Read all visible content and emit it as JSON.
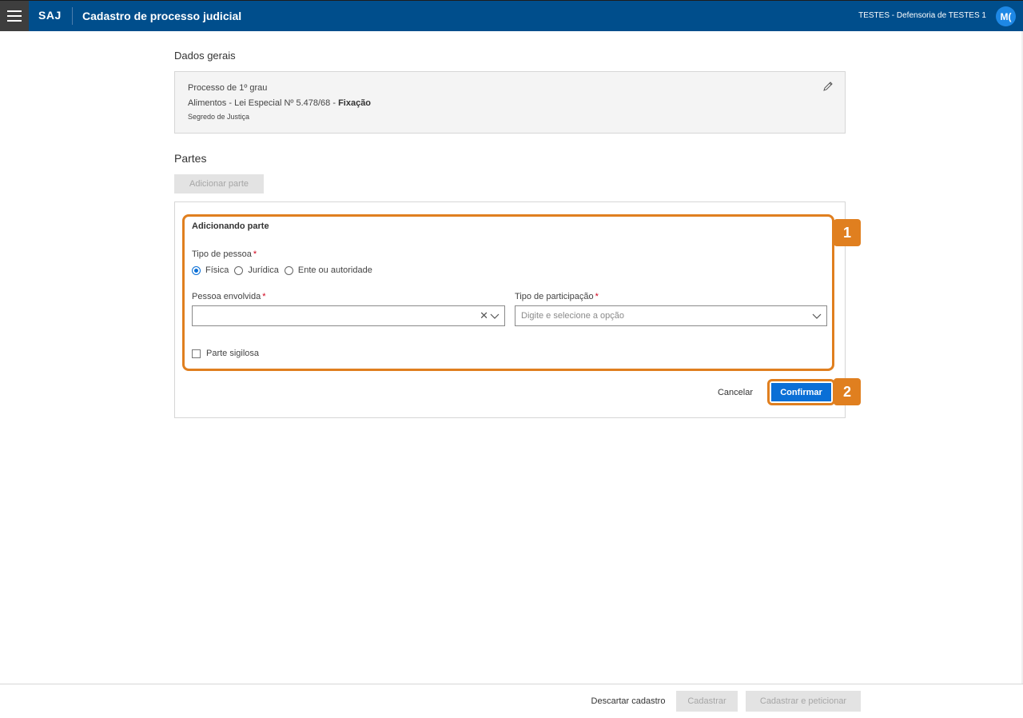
{
  "header": {
    "brand": "SAJ",
    "title": "Cadastro de processo judicial",
    "user_org": "TESTES - Defensoria de TESTES 1",
    "avatar_initials": "M("
  },
  "dados_gerais": {
    "title": "Dados gerais",
    "line1": "Processo de 1º grau",
    "line2_prefix": "Alimentos - Lei Especial Nº 5.478/68 - ",
    "line2_bold": "Fixação",
    "line3": "Segredo de Justiça"
  },
  "partes": {
    "title": "Partes",
    "add_button": "Adicionar parte"
  },
  "form": {
    "title": "Adicionando parte",
    "tipo_pessoa_label": "Tipo de pessoa",
    "required_mark": "*",
    "radio_options": [
      "Física",
      "Jurídica",
      "Ente ou autoridade"
    ],
    "radio_selected": "Física",
    "pessoa_label": "Pessoa envolvida",
    "pessoa_value": "",
    "participacao_label": "Tipo de participação",
    "participacao_placeholder": "Digite e selecione a opção",
    "sigilosa_label": "Parte sigilosa",
    "cancel": "Cancelar",
    "confirm": "Confirmar"
  },
  "callouts": {
    "one": "1",
    "two": "2",
    "color": "#e07f1f"
  },
  "footer": {
    "discard": "Descartar cadastro",
    "cadastrar": "Cadastrar",
    "cadastrar_peticionar": "Cadastrar e peticionar"
  },
  "colors": {
    "topbar": "#004e8c",
    "primary": "#0a6fd6",
    "disabled_bg": "#e3e3e3"
  }
}
